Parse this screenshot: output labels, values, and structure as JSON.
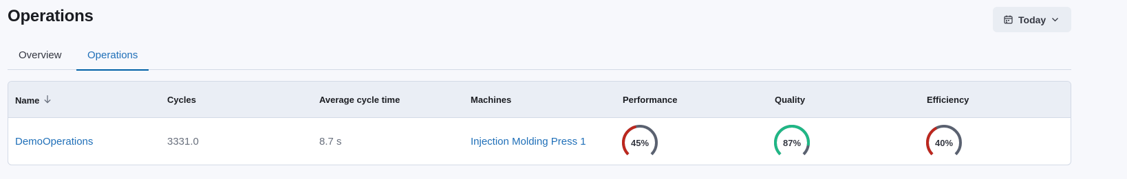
{
  "header": {
    "title": "Operations",
    "date_button": {
      "label": "Today",
      "icon": "calendar-icon",
      "chevron": "chevron-down-icon"
    }
  },
  "tabs": [
    {
      "label": "Overview",
      "active": false
    },
    {
      "label": "Operations",
      "active": true
    }
  ],
  "table": {
    "columns": {
      "name": "Name",
      "cycles": "Cycles",
      "avg_cycle_time": "Average cycle time",
      "machines": "Machines",
      "performance": "Performance",
      "quality": "Quality",
      "efficiency": "Efficiency"
    },
    "sort_icon": "arrow-down-icon",
    "rows": [
      {
        "name": "DemoOperations",
        "cycles": "3331.0",
        "avg_cycle_time": "8.7 s",
        "machines": "Injection Molding Press 1",
        "performance": {
          "value": 0.45,
          "label": "45%",
          "color": "#bd271e"
        },
        "quality": {
          "value": 0.87,
          "label": "87%",
          "color": "#1fb785"
        },
        "efficiency": {
          "value": 0.4,
          "label": "40%",
          "color": "#bd271e"
        }
      }
    ]
  },
  "colors": {
    "accent": "#1f6fb8",
    "gauge_track": "#5a6170",
    "bad": "#bd271e",
    "good": "#1fb785"
  }
}
